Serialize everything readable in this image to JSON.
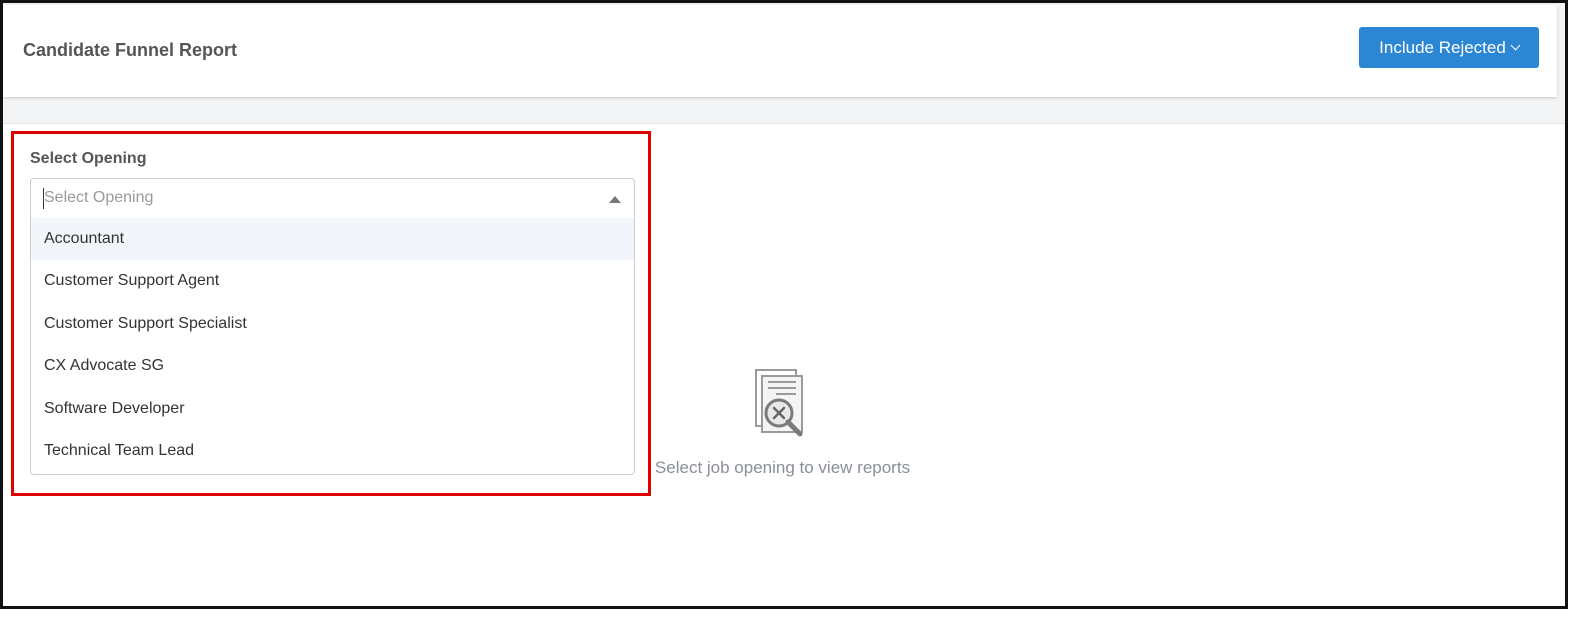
{
  "header": {
    "title": "Candidate Funnel Report",
    "include_button_label": "Include Rejected"
  },
  "opening_select": {
    "label": "Select Opening",
    "placeholder": "Select Opening",
    "options": [
      "Accountant",
      "Customer Support Agent",
      "Customer Support Specialist",
      "CX Advocate SG",
      "Software Developer",
      "Technical Team Lead"
    ],
    "highlighted_option": "Accountant"
  },
  "empty_state": {
    "icon": "document-search-x-icon",
    "message": "Select job opening to view reports"
  },
  "colors": {
    "primary_button": "#2b87d3",
    "highlight_border": "#e00000"
  }
}
